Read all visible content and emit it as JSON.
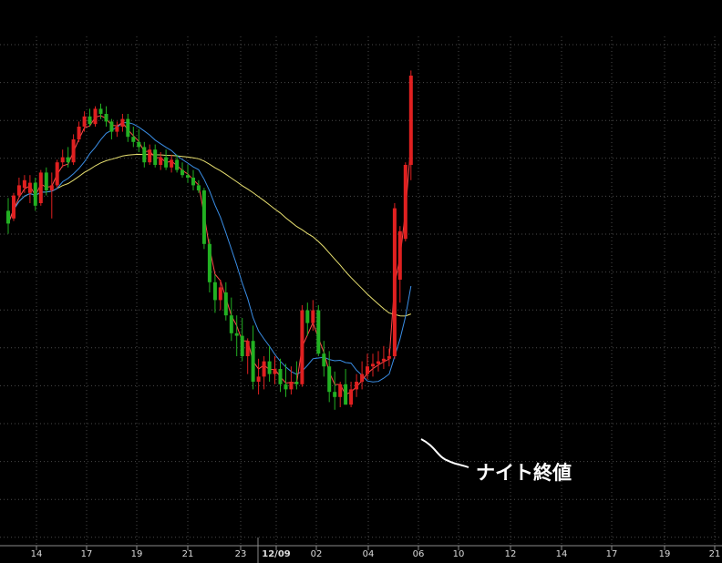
{
  "chart_data": {
    "type": "candlestick",
    "x_tick_labels": [
      "14",
      "17",
      "19",
      "21",
      "23",
      "12/09",
      "02",
      "04",
      "06",
      "10",
      "12",
      "14",
      "17",
      "19",
      "21"
    ],
    "y_range": [
      0,
      100
    ],
    "grid": true,
    "colors": {
      "background": "#000000",
      "up": "#e02020",
      "down": "#22b022",
      "ma_short": "#ff4a4a",
      "ma_medium": "#3a8ee6",
      "ma_long": "#e8e070",
      "grid": "#4a4a4a",
      "axis": "#8a8a8a"
    },
    "annotation": {
      "text": "ナイト終値"
    },
    "candles": [
      {
        "o": 37,
        "h": 42,
        "l": 28,
        "c": 32
      },
      {
        "o": 34,
        "h": 44,
        "l": 33,
        "c": 43
      },
      {
        "o": 43,
        "h": 50,
        "l": 42,
        "c": 47
      },
      {
        "o": 46,
        "h": 51,
        "l": 44,
        "c": 49
      },
      {
        "o": 44,
        "h": 51,
        "l": 40,
        "c": 48
      },
      {
        "o": 48,
        "h": 50,
        "l": 37,
        "c": 39
      },
      {
        "o": 40,
        "h": 53,
        "l": 39,
        "c": 52
      },
      {
        "o": 52,
        "h": 54,
        "l": 43,
        "c": 45
      },
      {
        "o": 45,
        "h": 52,
        "l": 34,
        "c": 47
      },
      {
        "o": 47,
        "h": 57,
        "l": 46,
        "c": 56
      },
      {
        "o": 56,
        "h": 61,
        "l": 54,
        "c": 58
      },
      {
        "o": 58,
        "h": 62,
        "l": 54,
        "c": 56
      },
      {
        "o": 56,
        "h": 67,
        "l": 55,
        "c": 65
      },
      {
        "o": 65,
        "h": 72,
        "l": 64,
        "c": 70
      },
      {
        "o": 70,
        "h": 76,
        "l": 68,
        "c": 74
      },
      {
        "o": 74,
        "h": 77,
        "l": 70,
        "c": 71
      },
      {
        "o": 71,
        "h": 78,
        "l": 70,
        "c": 77
      },
      {
        "o": 77,
        "h": 79,
        "l": 73,
        "c": 75
      },
      {
        "o": 75,
        "h": 78,
        "l": 70,
        "c": 72
      },
      {
        "o": 72,
        "h": 73,
        "l": 65,
        "c": 68
      },
      {
        "o": 68,
        "h": 72,
        "l": 66,
        "c": 70
      },
      {
        "o": 70,
        "h": 75,
        "l": 68,
        "c": 73
      },
      {
        "o": 73,
        "h": 75,
        "l": 64,
        "c": 66
      },
      {
        "o": 66,
        "h": 70,
        "l": 62,
        "c": 64
      },
      {
        "o": 64,
        "h": 69,
        "l": 60,
        "c": 62
      },
      {
        "o": 62,
        "h": 64,
        "l": 54,
        "c": 56
      },
      {
        "o": 56,
        "h": 63,
        "l": 55,
        "c": 61
      },
      {
        "o": 61,
        "h": 63,
        "l": 54,
        "c": 55
      },
      {
        "o": 55,
        "h": 60,
        "l": 53,
        "c": 58
      },
      {
        "o": 58,
        "h": 61,
        "l": 53,
        "c": 54
      },
      {
        "o": 54,
        "h": 59,
        "l": 52,
        "c": 57
      },
      {
        "o": 57,
        "h": 59,
        "l": 52,
        "c": 53
      },
      {
        "o": 53,
        "h": 56,
        "l": 50,
        "c": 51
      },
      {
        "o": 51,
        "h": 55,
        "l": 48,
        "c": 50
      },
      {
        "o": 50,
        "h": 53,
        "l": 45,
        "c": 47
      },
      {
        "o": 47,
        "h": 49,
        "l": 44,
        "c": 45
      },
      {
        "o": 45,
        "h": 46,
        "l": 22,
        "c": 24
      },
      {
        "o": 24,
        "h": 26,
        "l": 5,
        "c": 9
      },
      {
        "o": 9,
        "h": 12,
        "l": -3,
        "c": 2
      },
      {
        "o": 2,
        "h": 10,
        "l": -2,
        "c": 7
      },
      {
        "o": 5,
        "h": 9,
        "l": -6,
        "c": -4
      },
      {
        "o": -4,
        "h": 3,
        "l": -14,
        "c": -11
      },
      {
        "o": -11,
        "h": -4,
        "l": -20,
        "c": -12
      },
      {
        "o": -12,
        "h": -5,
        "l": -22,
        "c": -20
      },
      {
        "o": -20,
        "h": -13,
        "l": -27,
        "c": -14
      },
      {
        "o": -14,
        "h": -8,
        "l": -33,
        "c": -30
      },
      {
        "o": -30,
        "h": -21,
        "l": -35,
        "c": -28
      },
      {
        "o": -28,
        "h": -20,
        "l": -33,
        "c": -22
      },
      {
        "o": -22,
        "h": -16,
        "l": -30,
        "c": -27
      },
      {
        "o": -27,
        "h": -20,
        "l": -31,
        "c": -25
      },
      {
        "o": -25,
        "h": -21,
        "l": -34,
        "c": -31
      },
      {
        "o": -31,
        "h": -23,
        "l": -36,
        "c": -33
      },
      {
        "o": -33,
        "h": -24,
        "l": -35,
        "c": -30
      },
      {
        "o": -30,
        "h": -22,
        "l": -33,
        "c": -31
      },
      {
        "o": -31,
        "h": 0,
        "l": -32,
        "c": -2
      },
      {
        "o": -2,
        "h": 1,
        "l": -12,
        "c": -7
      },
      {
        "o": -7,
        "h": 2,
        "l": -10,
        "c": -2
      },
      {
        "o": -2,
        "h": 0,
        "l": -20,
        "c": -19
      },
      {
        "o": -19,
        "h": -14,
        "l": -28,
        "c": -24
      },
      {
        "o": -24,
        "h": -18,
        "l": -38,
        "c": -34
      },
      {
        "o": -34,
        "h": -26,
        "l": -41,
        "c": -36
      },
      {
        "o": -36,
        "h": -30,
        "l": -40,
        "c": -31
      },
      {
        "o": -31,
        "h": -25,
        "l": -39,
        "c": -39
      },
      {
        "o": -39,
        "h": -30,
        "l": -40,
        "c": -33
      },
      {
        "o": -33,
        "h": -27,
        "l": -36,
        "c": -30
      },
      {
        "o": -30,
        "h": -22,
        "l": -33,
        "c": -27
      },
      {
        "o": -27,
        "h": -19,
        "l": -29,
        "c": -24
      },
      {
        "o": -24,
        "h": -19,
        "l": -28,
        "c": -23
      },
      {
        "o": -23,
        "h": -18,
        "l": -26,
        "c": -22
      },
      {
        "o": -22,
        "h": -16,
        "l": -25,
        "c": -21
      },
      {
        "o": -21,
        "h": -17,
        "l": -24,
        "c": -20
      },
      {
        "o": -20,
        "h": 40,
        "l": -21,
        "c": 38
      },
      {
        "o": 10,
        "h": 31,
        "l": 1,
        "c": 29
      },
      {
        "o": 26,
        "h": 56,
        "l": 25,
        "c": 55
      },
      {
        "o": 55,
        "h": 92,
        "l": 49,
        "c": 90
      }
    ]
  }
}
